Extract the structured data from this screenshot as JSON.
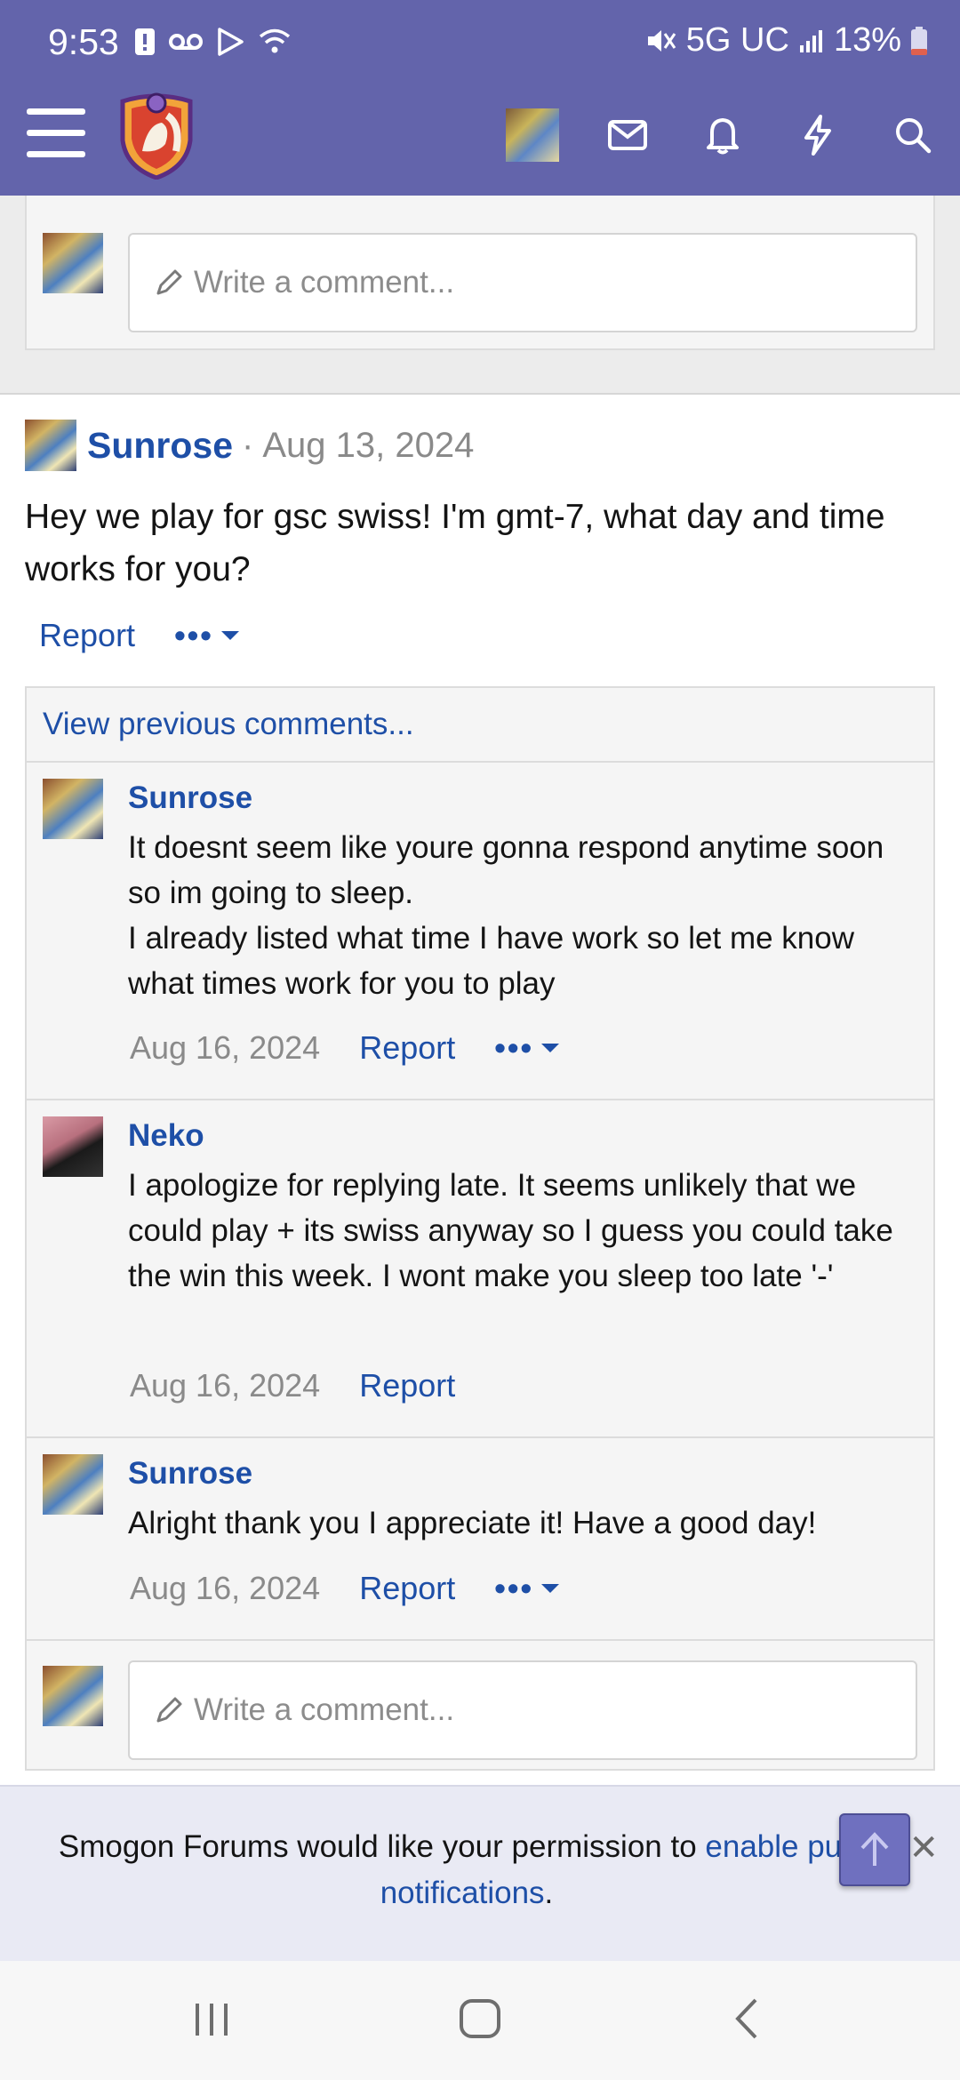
{
  "status_bar": {
    "time": "9:53",
    "network": "5G UC",
    "battery": "13%"
  },
  "colors": {
    "header": "#6364ab",
    "link": "#1e4fa7",
    "muted": "#8a8a8a"
  },
  "header": {
    "icons": [
      "menu-icon",
      "site-logo",
      "user-avatar",
      "mail-icon",
      "bell-icon",
      "lightning-icon",
      "search-icon"
    ]
  },
  "top_reply": {
    "placeholder": "Write a comment..."
  },
  "post": {
    "author": "Sunrose",
    "separator": "·",
    "date": "Aug 13, 2024",
    "body": "Hey we play for gsc swiss! I'm gmt-7, what day and time works for you?",
    "report_label": "Report",
    "more_label": "•••"
  },
  "comments": {
    "view_previous": "View previous comments...",
    "items": [
      {
        "author": "Sunrose",
        "text": "It doesnt seem like youre gonna respond anytime soon so im going to sleep.\nI already listed what time I have work so let me know what times work for you to play",
        "date": "Aug 16, 2024",
        "report": "Report",
        "more": "•••"
      },
      {
        "author": "Neko",
        "text": "I apologize for replying late. It seems unlikely that we could play + its swiss anyway so I guess you could take the win this week. I wont make you sleep too late '-'",
        "date": "Aug 16, 2024",
        "report": "Report"
      },
      {
        "author": "Sunrose",
        "text": "Alright thank you I appreciate it! Have a good day!",
        "date": "Aug 16, 2024",
        "report": "Report",
        "more": "•••"
      }
    ],
    "reply_placeholder": "Write a comment..."
  },
  "push_notice": {
    "text": "Smogon Forums would like your permission to ",
    "link": "enable push notifications",
    "end": ".",
    "close": "✕"
  }
}
